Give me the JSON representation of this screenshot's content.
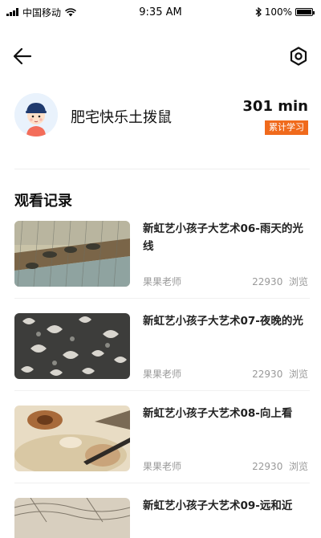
{
  "status_bar": {
    "carrier": "中国移动",
    "time": "9:35 AM",
    "battery": "100%"
  },
  "nav": {
    "back_icon": "arrow-left-icon",
    "settings_icon": "hexagon-settings-icon"
  },
  "profile": {
    "username": "肥宅快乐土拨鼠",
    "study_minutes": "301 min",
    "study_badge": "累计学习"
  },
  "history": {
    "title": "观看记录",
    "items": [
      {
        "title": "新虹艺小孩子大艺术06-雨天的光线",
        "teacher": "果果老师",
        "views": "22930",
        "views_label": "浏览"
      },
      {
        "title": "新虹艺小孩子大艺术07-夜晚的光",
        "teacher": "果果老师",
        "views": "22930",
        "views_label": "浏览"
      },
      {
        "title": "新虹艺小孩子大艺术08-向上看",
        "teacher": "果果老师",
        "views": "22930",
        "views_label": "浏览"
      },
      {
        "title": "新虹艺小孩子大艺术09-远和近",
        "teacher": "",
        "views": "",
        "views_label": ""
      }
    ]
  },
  "colors": {
    "accent": "#f06a1c",
    "muted_text": "#999999"
  }
}
